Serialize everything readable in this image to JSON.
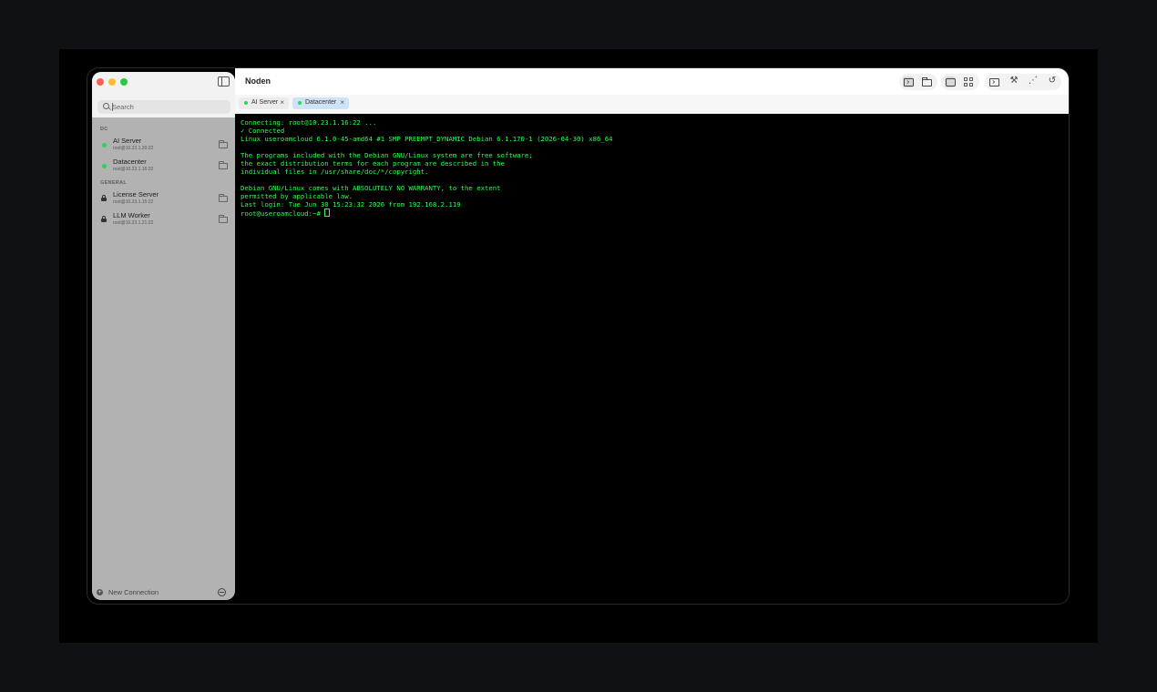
{
  "app": {
    "title": "Noden"
  },
  "search": {
    "placeholder": "Search"
  },
  "sidebar": {
    "sections": [
      {
        "label": "DC",
        "items": [
          {
            "name": "AI Server",
            "address": "root@10.23.1.20:22",
            "status": "connected"
          },
          {
            "name": "Datacenter",
            "address": "root@10.23.1.16:22",
            "status": "connected"
          }
        ]
      },
      {
        "label": "GENERAL",
        "items": [
          {
            "name": "License Server",
            "address": "root@10.23.1.15:22",
            "status": "locked"
          },
          {
            "name": "LLM Worker",
            "address": "root@10.23.1.21:22",
            "status": "locked"
          }
        ]
      }
    ],
    "new_connection_label": "New Connection"
  },
  "tabs": [
    {
      "label": "AI Server",
      "close": "×",
      "active": false
    },
    {
      "label": "Datacenter",
      "close": "×",
      "active": true
    }
  ],
  "terminal": {
    "lines": [
      "Connecting: root@10.23.1.16:22 ...",
      "✓ Connected",
      "Linux useroamcloud 6.1.0-45-amd64 #1 SMP PREEMPT_DYNAMIC Debian 6.1.170-1 (2026-04-30) x86_64",
      "",
      "The programs included with the Debian GNU/Linux system are free software;",
      "the exact distribution terms for each program are described in the",
      "individual files in /usr/share/doc/*/copyright.",
      "",
      "Debian GNU/Linux comes with ABSOLUTELY NO WARRANTY, to the extent",
      "permitted by applicable law.",
      "Last login: Tue Jun 30 15:23:32 2026 from 192.168.2.119"
    ],
    "prompt": "root@useroamcloud:~# "
  },
  "toolbar": {
    "icons": [
      "terminal-icon",
      "folder-icon",
      "single-pane-icon",
      "grid-icon",
      "console-icon",
      "hammer-icon",
      "magic-wand-icon",
      "history-icon"
    ]
  },
  "colors": {
    "terminal_text": "#2bff4f",
    "status_connected": "#2bd45a",
    "active_tab": "#cfe3f7"
  }
}
